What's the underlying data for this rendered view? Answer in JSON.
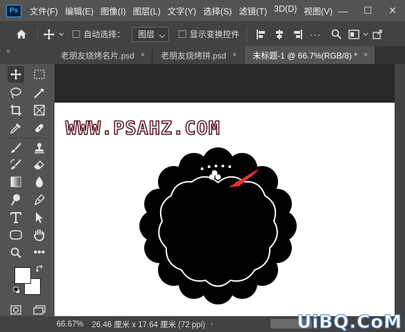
{
  "app": {
    "logo_text": "Ps",
    "menu": [
      "文件(F)",
      "编辑(E)",
      "图像(I)",
      "图层(L)",
      "文字(Y)",
      "选择(S)",
      "滤镜(T)",
      "3D(D)",
      "视图(V)"
    ],
    "window_controls": {
      "minimize": "—",
      "maximize": "☐",
      "close": "✕"
    }
  },
  "options_bar": {
    "auto_select_label": "自动选择：",
    "auto_select_target": "图层",
    "show_transform_label": "显示变换控件",
    "auto_select_checked": false,
    "show_transform_checked": false
  },
  "tabs": [
    {
      "label": "老朋友烧烤名片.psd",
      "close": "×",
      "active": false
    },
    {
      "label": "老朋友烧烤拼.psd",
      "close": "×",
      "active": false
    },
    {
      "label": "未标题-1 @ 66.7%(RGB/8) *",
      "close": "×",
      "active": true
    }
  ],
  "panel_collapse": "«",
  "canvas": {
    "watermark_text": "WWW.PSAHZ.COM"
  },
  "status": {
    "zoom": "66.67%",
    "doc_info": "26.46 厘米 x 17.64 厘米 (72 ppi)",
    "arrow": "›"
  },
  "site_watermark": "UiBQ.CoM",
  "colors": {
    "foreground": "#ffffff",
    "background": "#ffffff",
    "badge": "#000000",
    "arrow_accent": "#e8343a",
    "watermark_outline": "#5a1a22"
  }
}
